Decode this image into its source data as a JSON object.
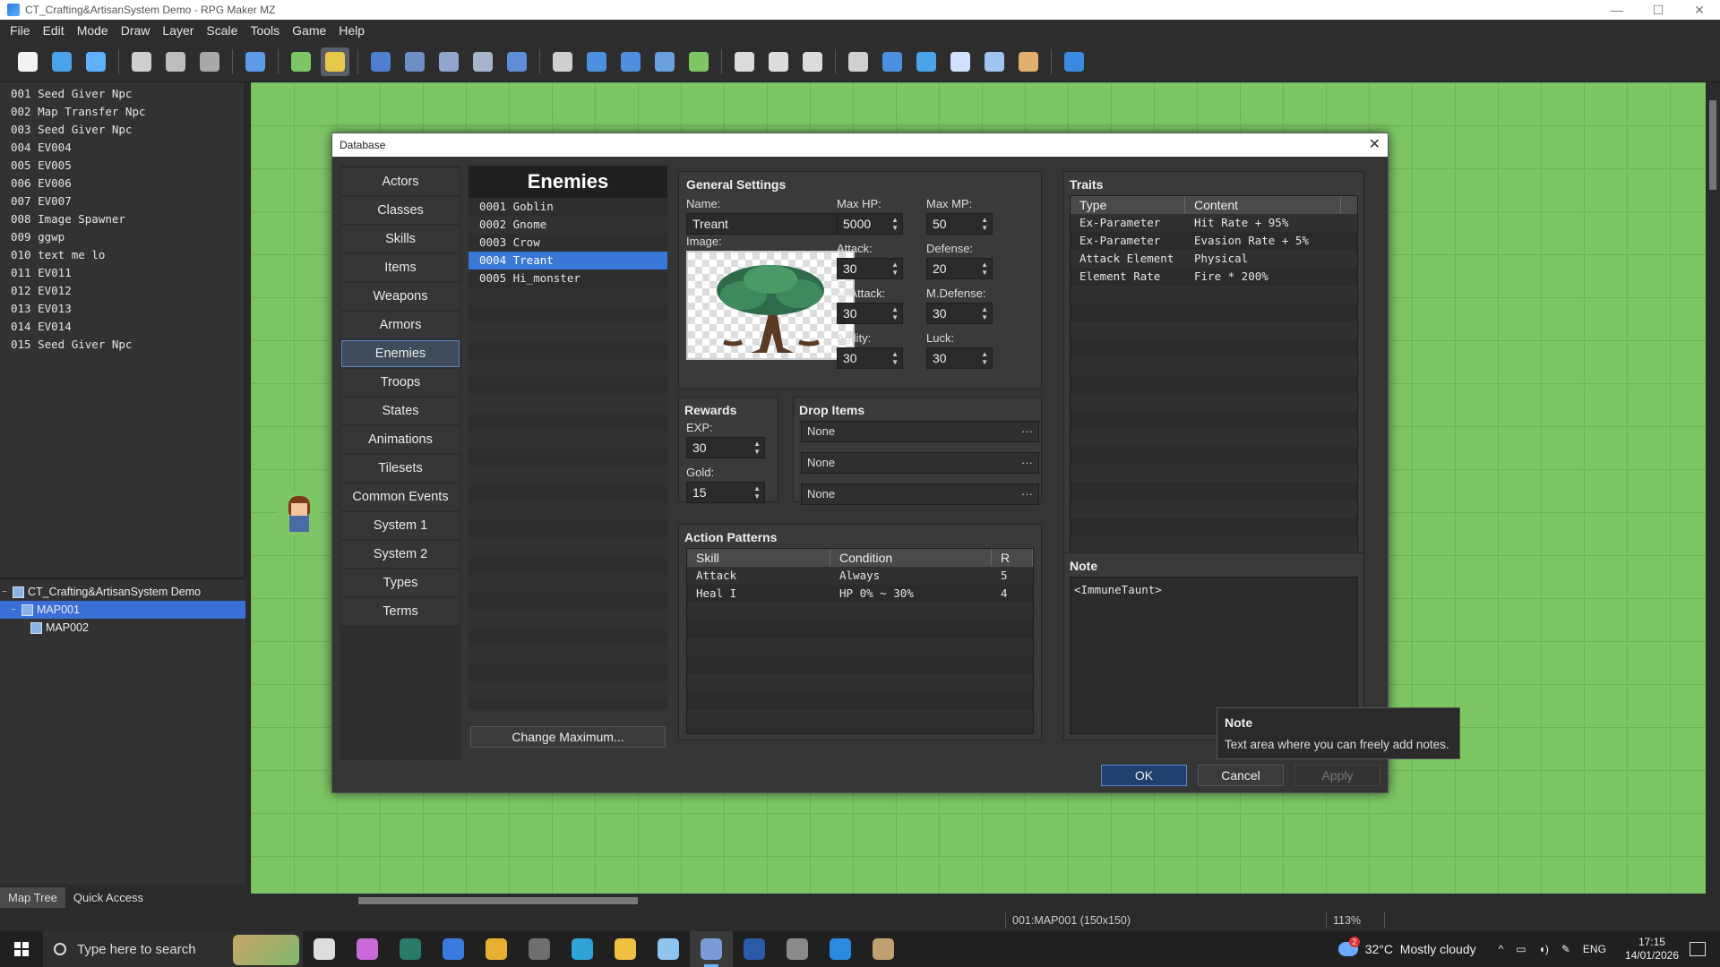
{
  "window": {
    "title": "CT_Crafting&ArtisanSystem Demo - RPG Maker MZ",
    "controls": [
      "—",
      "☐",
      "✕"
    ]
  },
  "menu": [
    "File",
    "Edit",
    "Mode",
    "Draw",
    "Layer",
    "Scale",
    "Tools",
    "Game",
    "Help"
  ],
  "toolbar_icons": [
    {
      "name": "new-project-icon",
      "color": "#f2f2f2"
    },
    {
      "name": "open-project-icon",
      "color": "#4aa3e8"
    },
    {
      "name": "save-project-icon",
      "color": "#5fb0ff"
    },
    {
      "sep": true
    },
    {
      "name": "cut-icon",
      "color": "#cfcfcf"
    },
    {
      "name": "copy-icon",
      "color": "#bdbdbd"
    },
    {
      "name": "paste-icon",
      "color": "#a9a9a9"
    },
    {
      "sep": true
    },
    {
      "name": "undo-icon",
      "color": "#5b9be8"
    },
    {
      "sep": true
    },
    {
      "name": "map-mode-icon",
      "color": "#7cc664"
    },
    {
      "name": "event-mode-icon",
      "color": "#e6c84a",
      "active": true
    },
    {
      "sep": true
    },
    {
      "name": "layer-1-icon",
      "color": "#4f7fd0"
    },
    {
      "name": "layer-2-icon",
      "color": "#6c8fc8"
    },
    {
      "name": "layer-3-icon",
      "color": "#8fa7cf"
    },
    {
      "name": "layer-4-icon",
      "color": "#a7b5cc"
    },
    {
      "name": "layer-auto-icon",
      "color": "#5e8ed8"
    },
    {
      "sep": true
    },
    {
      "name": "pencil-icon",
      "color": "#cfcfcf"
    },
    {
      "name": "rectangle-icon",
      "color": "#4f8fe0"
    },
    {
      "name": "ellipse-icon",
      "color": "#4f8fe0"
    },
    {
      "name": "flood-fill-icon",
      "color": "#6aa0e0"
    },
    {
      "name": "shadow-pen-icon",
      "color": "#7cc664"
    },
    {
      "sep": true
    },
    {
      "name": "zoom-in-icon",
      "color": "#dcdcdc"
    },
    {
      "name": "zoom-out-icon",
      "color": "#dcdcdc"
    },
    {
      "name": "zoom-actual-icon",
      "color": "#dcdcdc"
    },
    {
      "sep": true
    },
    {
      "name": "database-icon",
      "color": "#d0d0d0"
    },
    {
      "name": "plugin-manager-icon",
      "color": "#4a8fe0"
    },
    {
      "name": "sound-test-icon",
      "color": "#4aa3e8"
    },
    {
      "name": "event-searcher-icon",
      "color": "#cfe2ff"
    },
    {
      "name": "resource-manager-icon",
      "color": "#a0c4f0"
    },
    {
      "name": "character-generator-icon",
      "color": "#e0b070"
    },
    {
      "sep": true
    },
    {
      "name": "playtest-icon",
      "color": "#3a8be0"
    }
  ],
  "event_list": [
    "001 Seed Giver Npc",
    "002 Map Transfer Npc",
    "003 Seed Giver Npc",
    "004 EV004",
    "005 EV005",
    "006 EV006",
    "007 EV007",
    "008 Image Spawner",
    "009 ggwp",
    "010 text me lo",
    "011 EV011",
    "012 EV012",
    "013 EV013",
    "014 EV014",
    "015 Seed Giver Npc"
  ],
  "map_tree": {
    "project": "CT_Crafting&ArtisanSystem Demo",
    "maps": [
      {
        "label": "MAP001",
        "selected": true
      },
      {
        "label": "MAP002",
        "selected": false
      }
    ]
  },
  "left_tabs": [
    "Map Tree",
    "Quick Access"
  ],
  "status": {
    "map": "001:MAP001 (150x150)",
    "zoom": "113%"
  },
  "database": {
    "title": "Database",
    "categories": [
      "Actors",
      "Classes",
      "Skills",
      "Items",
      "Weapons",
      "Armors",
      "Enemies",
      "Troops",
      "States",
      "Animations",
      "Tilesets",
      "Common Events",
      "System 1",
      "System 2",
      "Types",
      "Terms"
    ],
    "selected_category": "Enemies",
    "list_header": "Enemies",
    "enemies": [
      "0001 Goblin",
      "0002 Gnome",
      "0003 Crow",
      "0004 Treant",
      "0005 Hi_monster"
    ],
    "selected_enemy": "0004 Treant",
    "change_max": "Change Maximum...",
    "general": {
      "heading": "General Settings",
      "name_label": "Name:",
      "name": "Treant",
      "image_label": "Image:",
      "maxhp_label": "Max HP:",
      "maxhp": "5000",
      "maxmp_label": "Max MP:",
      "maxmp": "50",
      "atk_label": "Attack:",
      "atk": "30",
      "def_label": "Defense:",
      "def": "20",
      "matk_label": "M.Attack:",
      "matk": "30",
      "mdef_label": "M.Defense:",
      "mdef": "30",
      "agi_label": "Agility:",
      "agi": "30",
      "luk_label": "Luck:",
      "luk": "30"
    },
    "rewards": {
      "heading": "Rewards",
      "exp_label": "EXP:",
      "exp": "30",
      "gold_label": "Gold:",
      "gold": "15"
    },
    "drops": {
      "heading": "Drop Items",
      "items": [
        "None",
        "None",
        "None"
      ],
      "dots": "···"
    },
    "actions": {
      "heading": "Action Patterns",
      "columns": [
        "Skill",
        "Condition",
        "R"
      ],
      "rows": [
        {
          "skill": "Attack",
          "condition": "Always",
          "r": "5"
        },
        {
          "skill": "Heal I",
          "condition": "HP 0% ~ 30%",
          "r": "4"
        }
      ]
    },
    "traits": {
      "heading": "Traits",
      "columns": [
        "Type",
        "Content"
      ],
      "rows": [
        {
          "type": "Ex-Parameter",
          "content": "Hit Rate + 95%"
        },
        {
          "type": "Ex-Parameter",
          "content": "Evasion Rate + 5%"
        },
        {
          "type": "Attack Element",
          "content": "Physical"
        },
        {
          "type": "Element Rate",
          "content": "Fire * 200%"
        }
      ]
    },
    "note": {
      "heading": "Note",
      "text": "<ImmuneTaunt>"
    },
    "tooltip": {
      "title": "Note",
      "text": "Text area where you can freely add notes."
    },
    "buttons": {
      "ok": "OK",
      "cancel": "Cancel",
      "apply": "Apply"
    }
  },
  "taskbar": {
    "search_placeholder": "Type here to search",
    "apps": [
      {
        "name": "task-view-icon",
        "color": "#dddddd"
      },
      {
        "name": "copilot-icon",
        "color": "#c86ad8"
      },
      {
        "name": "terminal-app-icon",
        "color": "#2a7a6a"
      },
      {
        "name": "store-icon",
        "color": "#3a7be0"
      },
      {
        "name": "chrome-icon",
        "color": "#e8b030"
      },
      {
        "name": "calculator-icon",
        "color": "#6f6f6f"
      },
      {
        "name": "edge-icon",
        "color": "#2fa3d8"
      },
      {
        "name": "file-explorer-icon",
        "color": "#f0c040"
      },
      {
        "name": "notepad-icon",
        "color": "#8fc4f0"
      },
      {
        "name": "rpg-maker-icon",
        "color": "#7a9ad8",
        "active": true
      },
      {
        "name": "powershell-icon",
        "color": "#2a5aa8"
      },
      {
        "name": "settings-app-icon",
        "color": "#8a8a8a"
      },
      {
        "name": "vscode-icon",
        "color": "#2a8ae0"
      },
      {
        "name": "game-app-icon",
        "color": "#c0a070"
      }
    ],
    "weather_badge": "2",
    "weather": "32°C  Mostly cloudy",
    "lang": "ENG",
    "time": "17:15",
    "date": "14/01/2026",
    "tray_up": "^"
  }
}
